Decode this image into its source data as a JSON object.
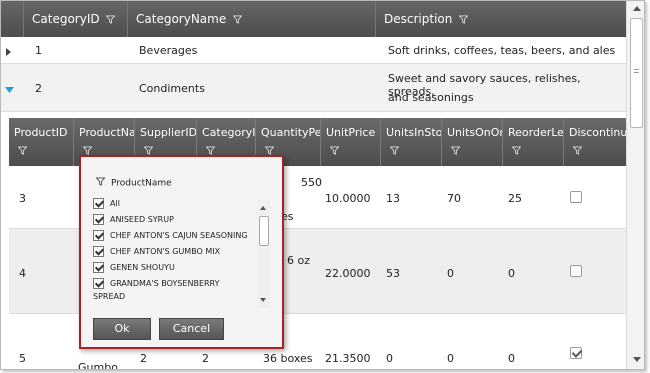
{
  "outer_grid": {
    "columns": [
      {
        "label": "CategoryID"
      },
      {
        "label": "CategoryName"
      },
      {
        "label": "Description"
      }
    ],
    "rows": [
      {
        "id": "1",
        "name": "Beverages",
        "description": "Soft drinks, coffees, teas, beers, and ales",
        "expanded": false
      },
      {
        "id": "2",
        "name": "Condiments",
        "description_line1": "Sweet and savory sauces, relishes, spreads,",
        "description_line2": "and seasonings",
        "expanded": true
      }
    ]
  },
  "nested_grid": {
    "columns": [
      {
        "label": "ProductID"
      },
      {
        "label": "ProductName"
      },
      {
        "label": "SupplierID"
      },
      {
        "label": "CategoryID"
      },
      {
        "label": "QuantityPerUnit"
      },
      {
        "label": "UnitPrice"
      },
      {
        "label": "UnitsInStock"
      },
      {
        "label": "UnitsOnOrder"
      },
      {
        "label": "ReorderLevel"
      },
      {
        "label": "Discontinued"
      }
    ],
    "rows": [
      {
        "product_id": "3",
        "qty_line1": "550",
        "qty_line2": "es",
        "unit_price": "10.0000",
        "in_stock": "13",
        "on_order": "70",
        "reorder": "25",
        "discontinued": false
      },
      {
        "product_id": "4",
        "qty": "6 oz",
        "unit_price": "22.0000",
        "in_stock": "53",
        "on_order": "0",
        "reorder": "0",
        "discontinued": false
      },
      {
        "product_id": "5",
        "product_name": "Gumbo",
        "supplier_id": "2",
        "category_id": "2",
        "qty": "36 boxes",
        "unit_price": "21.3500",
        "in_stock": "0",
        "on_order": "0",
        "reorder": "0",
        "discontinued": true
      }
    ]
  },
  "filter_popup": {
    "title": "ProductName",
    "items": [
      {
        "label": "All",
        "checked": true
      },
      {
        "label": "ANISEED SYRUP",
        "checked": true
      },
      {
        "label": "CHEF ANTON'S CAJUN SEASONING",
        "checked": true
      },
      {
        "label": "CHEF ANTON'S GUMBO MIX",
        "checked": true
      },
      {
        "label": "GENEN SHOUYU",
        "checked": true
      },
      {
        "label": "GRANDMA'S BOYSENBERRY",
        "continuation": "SPREAD",
        "checked": true
      }
    ],
    "ok_label": "Ok",
    "cancel_label": "Cancel"
  },
  "colors": {
    "header": "#555555",
    "popup_border": "#b02020",
    "expander_active": "#2a9fd6",
    "alt_row": "#eeeeee"
  },
  "icons": [
    "filter-icon",
    "expand-arrow-icon",
    "collapse-arrow-icon",
    "checkbox-icon",
    "scroll-up-icon",
    "scroll-down-icon"
  ]
}
